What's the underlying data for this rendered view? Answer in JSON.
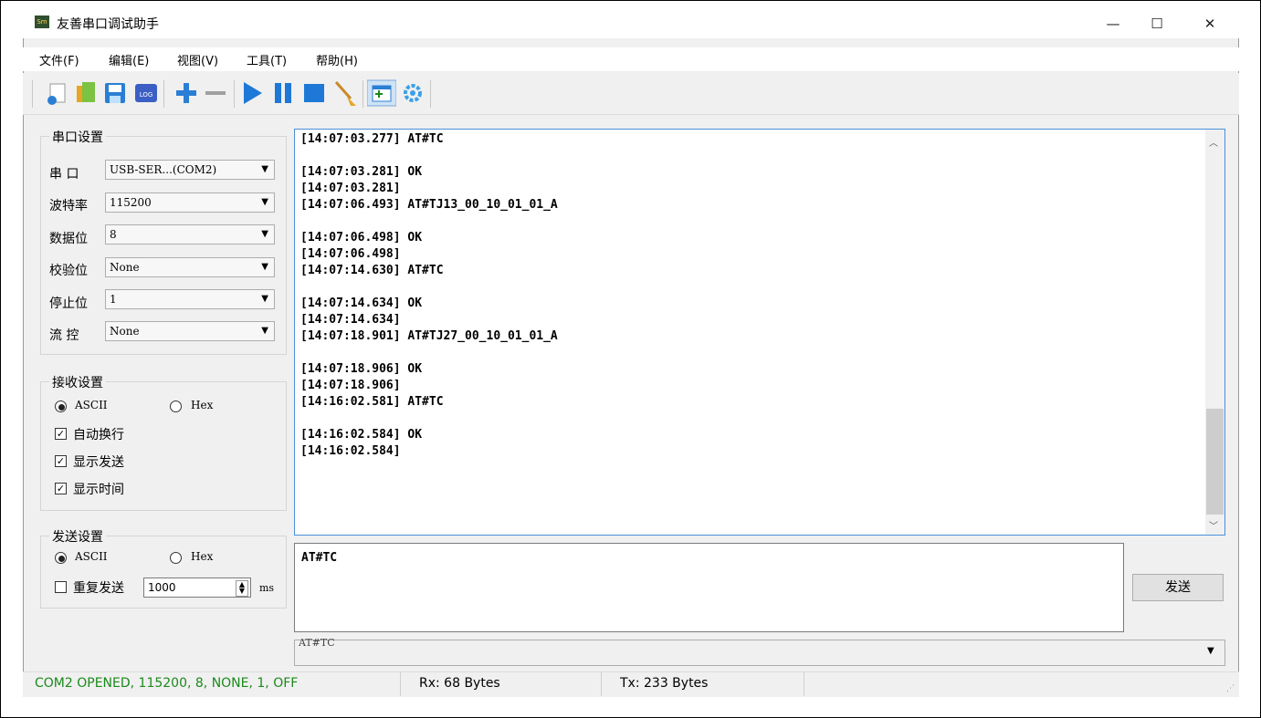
{
  "window": {
    "title": "友善串口调试助手",
    "icon_text": "Sm",
    "min": "—",
    "max": "☐",
    "close": "✕"
  },
  "menu": [
    "文件(F)",
    "编辑(E)",
    "视图(V)",
    "工具(T)",
    "帮助(H)"
  ],
  "toolbar": [
    "new-icon",
    "open-icon",
    "save-icon",
    "log-icon",
    "add-icon",
    "remove-icon",
    "play-icon",
    "pause-icon",
    "stop-icon",
    "clear-icon",
    "window-icon",
    "settings-icon"
  ],
  "toolbar_log_text": "LOG",
  "serial": {
    "title": "串口设置",
    "rows": [
      {
        "label": "串  口",
        "value": "USB-SER...(COM2)"
      },
      {
        "label": "波特率",
        "value": "115200"
      },
      {
        "label": "数据位",
        "value": "8"
      },
      {
        "label": "校验位",
        "value": "None"
      },
      {
        "label": "停止位",
        "value": "1"
      },
      {
        "label": "流  控",
        "value": "None"
      }
    ]
  },
  "receive": {
    "title": "接收设置",
    "ascii": "ASCII",
    "hex": "Hex",
    "auto_wrap": "自动换行",
    "show_send": "显示发送",
    "show_time": "显示时间",
    "check": "✓"
  },
  "send_settings": {
    "title": "发送设置",
    "ascii": "ASCII",
    "hex": "Hex",
    "repeat": "重复发送",
    "interval": "1000",
    "unit": "ms"
  },
  "recv_lines": [
    "[14:07:03.277] AT#TC",
    "",
    "[14:07:03.281] OK",
    "[14:07:03.281]",
    "[14:07:06.493] AT#TJ13_00_10_01_01_A",
    "",
    "[14:07:06.498] OK",
    "[14:07:06.498]",
    "[14:07:14.630] AT#TC",
    "",
    "[14:07:14.634] OK",
    "[14:07:14.634]",
    "[14:07:18.901] AT#TJ27_00_10_01_01_A",
    "",
    "[14:07:18.906] OK",
    "[14:07:18.906]",
    "[14:16:02.581] AT#TC",
    "",
    "[14:16:02.584] OK",
    "[14:16:02.584]"
  ],
  "send_text": "AT#TC",
  "send_button": "发送",
  "history_text": "AT#TC",
  "status": {
    "connection": "COM2 OPENED, 115200, 8, NONE, 1, OFF",
    "rx": "Rx: 68 Bytes",
    "tx": "Tx: 233 Bytes"
  },
  "colors": {
    "status_green": "#1a8a1a",
    "accent_blue": "#1e78d7"
  }
}
